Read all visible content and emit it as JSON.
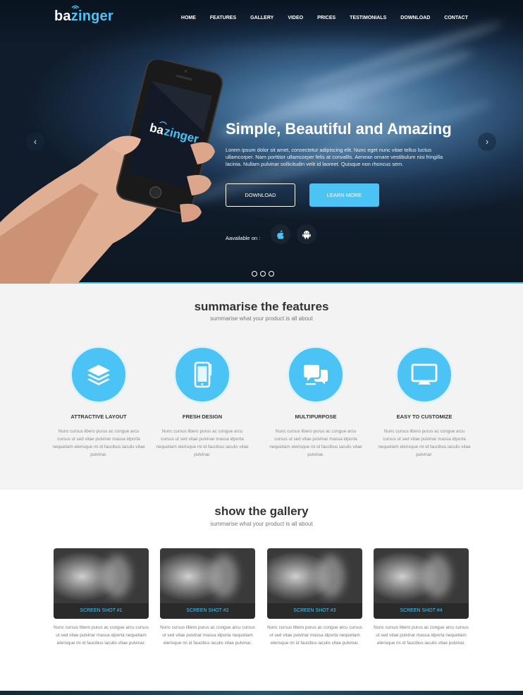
{
  "brand": {
    "logo_prefix": "ba",
    "logo_suffix": "zinger",
    "accent": "#4bc3f5"
  },
  "nav": [
    "HOME",
    "FEATURES",
    "GALLERY",
    "VIDEO",
    "PRICES",
    "TESTIMONIALS",
    "DOWNLOAD",
    "CONTACT"
  ],
  "hero": {
    "title_light": "Simple, Beautiful ",
    "title_bold": "and Amazing",
    "description": "Lorem ipsum dolor sit amet, consectetur adipiscing elit. Nunc eget nunc vitae tellus luctus ullamcorper. Nam porttitor ullamcorper felis at convallis. Aenean ornare vestibulum nisi fringilla lacinia. Nullam pulvinar sollicitudin velit id laoreet. Quisque non rhoncus sem.",
    "download_label": "DOWNLOAD",
    "learn_more_label": "LEARN MORE",
    "available_label": "Aavailable on :",
    "phone_logo_prefix": "ba",
    "phone_logo_suffix": "zinger"
  },
  "features": {
    "title": "summarise the features",
    "subtitle": "summarise what your product is all about",
    "items": [
      {
        "icon": "layers-icon",
        "title": "ATTRACTIVE LAYOUT",
        "description": "Nunc cursus libero purus ac congue arcu cursus ut sed vitae pulvinar massa idporta nequetiam elerisque mi id faucibus iaculis vitae pulvinar."
      },
      {
        "icon": "mobile-icon",
        "title": "FRESH DESIGN",
        "description": "Nunc cursus libero purus ac congue arcu cursus ut sed vitae pulvinar massa idporta nequetiam elerisque mi id faucibus iaculis vitae pulvinar."
      },
      {
        "icon": "chat-icon",
        "title": "MULTIPURPOSE",
        "description": "Nunc cursus libero purus ac congue arcu cursus ut sed vitae pulvinar massa idporta nequetiam elerisque mi id faucibus iaculis vitae pulvinar."
      },
      {
        "icon": "monitor-icon",
        "title": "EASY TO CUSTOMIZE",
        "description": "Nunc cursus libero purus ac congue arcu cursus ut sed vitae pulvinar massa idporta nequetiam elerisque mi id faucibus iaculis vitae pulvinar."
      }
    ]
  },
  "gallery": {
    "title": "show the gallery",
    "subtitle": "summarise what your product is all about",
    "items": [
      {
        "caption": "SCREEN SHOT #1",
        "description": "Nunc cursus libero purus ac congue arcu cursus ut sed vitae pulvinar massa idporta nequetiam elerisque mi id faucibus iaculis vitae pulvinar."
      },
      {
        "caption": "SCREEN SHOT #2",
        "description": "Nunc cursus libero purus ac congue arcu cursus ut sed vitae pulvinar massa idporta nequetiam elerisque mi id faucibus iaculis vitae pulvinar."
      },
      {
        "caption": "SCREEN SHOT #3",
        "description": "Nunc cursus libero purus ac congue arcu cursus ut sed vitae pulvinar massa idporta nequetiam elerisque mi id faucibus iaculis vitae pulvinar."
      },
      {
        "caption": "SCREEN SHOT #4",
        "description": "Nunc cursus libero purus ac congue arcu cursus ut sed vitae pulvinar massa idporta nequetiam elerisque mi id faucibus iaculis vitae pulvinar."
      }
    ]
  },
  "icons": {
    "prev_arrow": "chevron-left-icon",
    "next_arrow": "chevron-right-icon",
    "ios_store": "apple-icon",
    "android_store": "android-icon"
  }
}
